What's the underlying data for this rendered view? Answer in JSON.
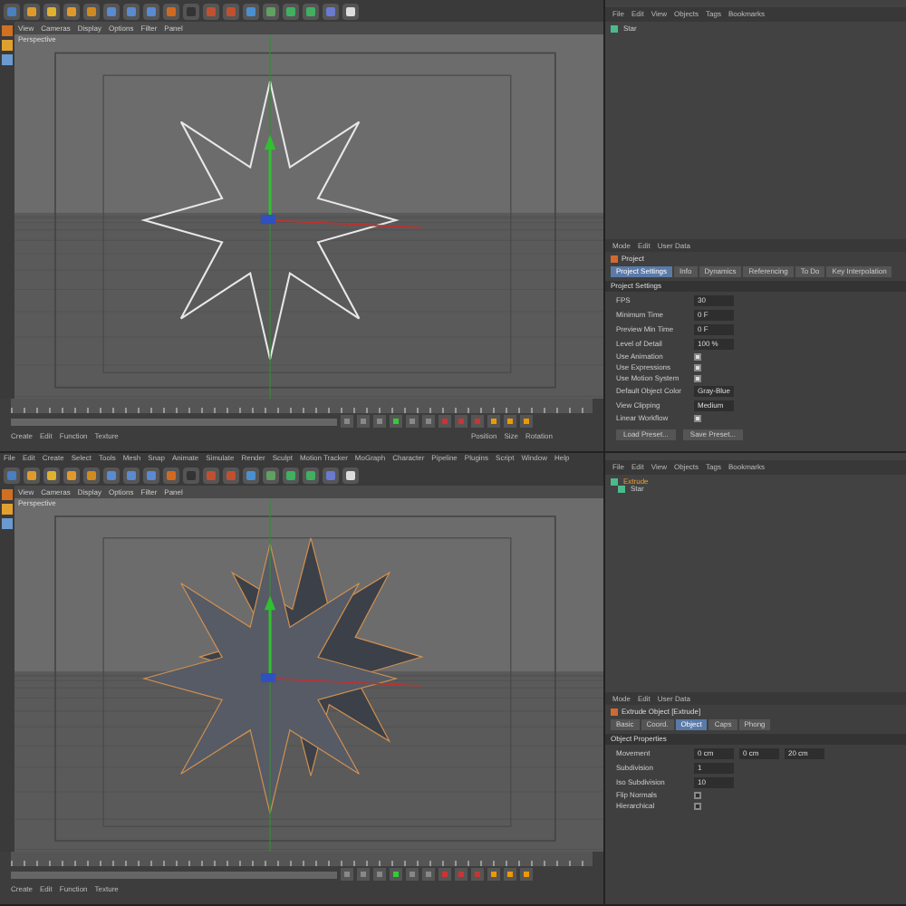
{
  "panes": [
    {
      "kind": "outline",
      "viewport_menu": [
        "View",
        "Cameras",
        "Display",
        "Options",
        "Filter",
        "Panel"
      ],
      "viewport_label": "Perspective",
      "object_menu": [
        "File",
        "Edit",
        "View",
        "Objects",
        "Tags",
        "Bookmarks"
      ],
      "objects": [
        {
          "name": "Star",
          "selected": false
        }
      ],
      "attributes": {
        "menu": [
          "Mode",
          "Edit",
          "User Data"
        ],
        "title": "Project",
        "tabs": [
          {
            "label": "Project Settings",
            "selected": true
          },
          {
            "label": "Info",
            "selected": false
          },
          {
            "label": "Dynamics",
            "selected": false
          },
          {
            "label": "Referencing",
            "selected": false
          },
          {
            "label": "To Do",
            "selected": false
          },
          {
            "label": "Key Interpolation",
            "selected": false
          }
        ],
        "section": "Project Settings",
        "rows": [
          {
            "kind": "field",
            "label": "FPS",
            "values": [
              "30"
            ]
          },
          {
            "kind": "field",
            "label": "Minimum Time",
            "values": [
              "0 F"
            ]
          },
          {
            "kind": "field",
            "label": "Preview Min Time",
            "values": [
              "0 F"
            ]
          },
          {
            "kind": "field",
            "label": "Level of Detail",
            "values": [
              "100 %"
            ]
          },
          {
            "kind": "check",
            "label": "Use Animation",
            "checked": true
          },
          {
            "kind": "check",
            "label": "Use Expressions",
            "checked": true
          },
          {
            "kind": "check",
            "label": "Use Motion System",
            "checked": true
          },
          {
            "kind": "field",
            "label": "Default Object Color",
            "values": [
              "Gray-Blue"
            ]
          },
          {
            "kind": "field",
            "label": "View Clipping",
            "values": [
              "Medium"
            ]
          },
          {
            "kind": "check",
            "label": "Linear Workflow",
            "checked": true
          }
        ],
        "buttons": [
          "Load Preset...",
          "Save Preset..."
        ]
      },
      "material_menu": [
        "Create",
        "Edit",
        "Function",
        "Texture"
      ],
      "coord_labels": [
        "Position",
        "Size",
        "Rotation"
      ]
    },
    {
      "kind": "extruded",
      "main_menu": [
        "File",
        "Edit",
        "Create",
        "Select",
        "Tools",
        "Mesh",
        "Snap",
        "Animate",
        "Simulate",
        "Render",
        "Sculpt",
        "Motion Tracker",
        "MoGraph",
        "Character",
        "Pipeline",
        "Plugins",
        "Script",
        "Window",
        "Help"
      ],
      "viewport_menu": [
        "View",
        "Cameras",
        "Display",
        "Options",
        "Filter",
        "Panel"
      ],
      "viewport_label": "Perspective",
      "object_menu": [
        "File",
        "Edit",
        "View",
        "Objects",
        "Tags",
        "Bookmarks"
      ],
      "objects": [
        {
          "name": "Extrude",
          "selected": true,
          "children": [
            {
              "name": "Star",
              "selected": false
            }
          ]
        }
      ],
      "attributes": {
        "menu": [
          "Mode",
          "Edit",
          "User Data"
        ],
        "title": "Extrude Object [Extrude]",
        "tabs": [
          {
            "label": "Basic",
            "selected": false
          },
          {
            "label": "Coord.",
            "selected": false
          },
          {
            "label": "Object",
            "selected": true
          },
          {
            "label": "Caps",
            "selected": false
          },
          {
            "label": "Phong",
            "selected": false
          }
        ],
        "section": "Object Properties",
        "rows": [
          {
            "kind": "field",
            "label": "Movement",
            "values": [
              "0 cm",
              "0 cm",
              "20 cm"
            ]
          },
          {
            "kind": "field",
            "label": "Subdivision",
            "values": [
              "1"
            ]
          },
          {
            "kind": "field",
            "label": "Iso Subdivision",
            "values": [
              "10"
            ]
          },
          {
            "kind": "check",
            "label": "Flip Normals",
            "checked": false
          },
          {
            "kind": "check",
            "label": "Hierarchical",
            "checked": false
          }
        ]
      },
      "material_menu": [
        "Create",
        "Edit",
        "Function",
        "Texture"
      ]
    }
  ]
}
